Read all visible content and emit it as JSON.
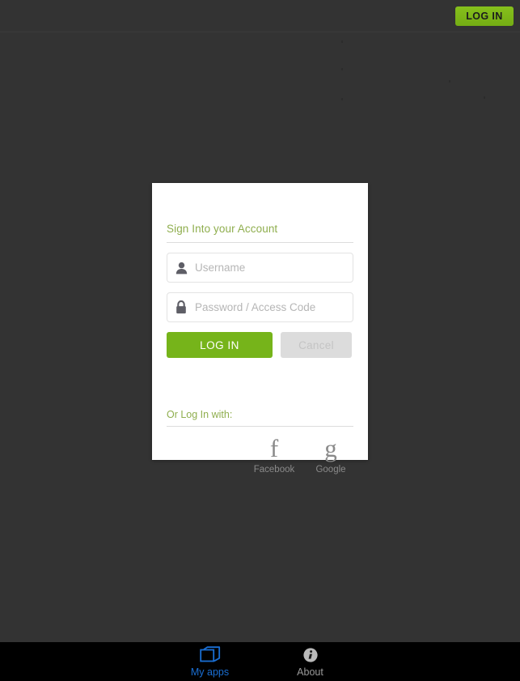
{
  "header": {
    "login_label": "LOG IN"
  },
  "card": {
    "heading": "Sign Into your Account",
    "username_placeholder": "Username",
    "username_value": "",
    "password_placeholder": "Password / Access Code",
    "password_value": "",
    "login_label": "LOG IN",
    "cancel_label": "Cancel",
    "social_heading": "Or Log In with:",
    "social": [
      {
        "glyph": "f",
        "label": "Facebook",
        "icon": "facebook-icon"
      },
      {
        "glyph": "g",
        "label": "Google",
        "icon": "google-icon"
      }
    ],
    "username_icon": "person-icon",
    "password_icon": "lock-icon"
  },
  "bottom_nav": {
    "items": [
      {
        "label": "My apps",
        "icon": "windows-stack-icon",
        "active": true
      },
      {
        "label": "About",
        "icon": "info-circle-icon",
        "active": false
      }
    ]
  },
  "colors": {
    "brand_green": "#76b41a",
    "header_green": "#7cb518",
    "heading_green": "#8fae4e",
    "backdrop": "#333333",
    "nav_active": "#1a6fd4",
    "nav_inactive": "#9a9a9a",
    "card_bg": "#ffffff"
  }
}
